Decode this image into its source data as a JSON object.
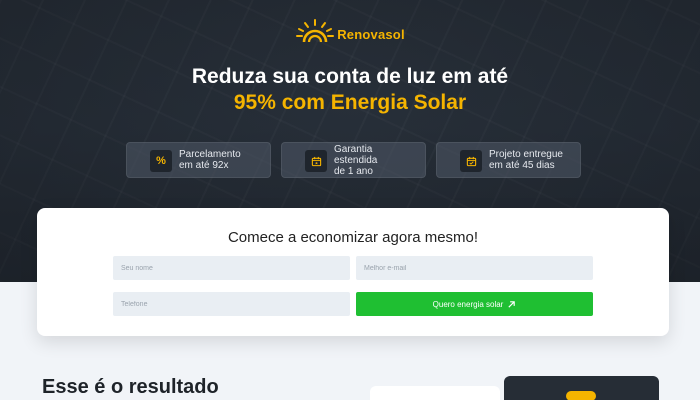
{
  "brand": {
    "name": "Renovasol",
    "accent": "#f5b400",
    "icon": "sun-logo-icon"
  },
  "hero": {
    "headline_line1": "Reduza sua conta de luz em até",
    "headline_line2": "95% com Energia Solar"
  },
  "features": [
    {
      "icon": "percent-icon",
      "line1": "Parcelamento",
      "line2": "em até 92x"
    },
    {
      "icon": "shield-calendar-icon",
      "line1": "Garantia estendida",
      "line2": "de 1 ano"
    },
    {
      "icon": "calendar-check-icon",
      "line1": "Projeto entregue",
      "line2": "em até 45 dias"
    }
  ],
  "form": {
    "title": "Comece a economizar agora mesmo!",
    "name_placeholder": "Seu nome",
    "email_placeholder": "Melhor e-mail",
    "phone_placeholder": "Telefone",
    "submit_label": "Quero energia solar",
    "submit_icon": "arrow-up-right-icon",
    "submit_color": "#1fbf32"
  },
  "results": {
    "title": "Esse é o resultado"
  }
}
